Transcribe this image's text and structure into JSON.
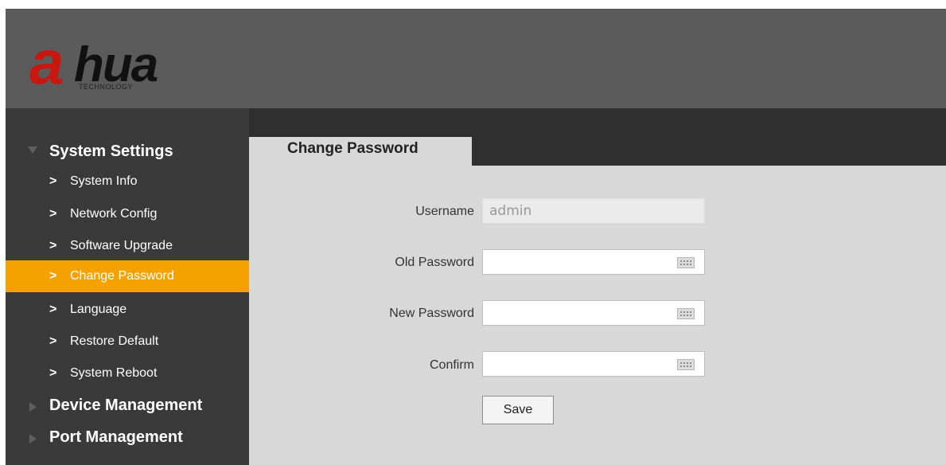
{
  "header": {
    "logo": {
      "brand": "alhua",
      "at_glyph": "a",
      "wordmark": "hua",
      "tagline": "TECHNOLOGY",
      "colors": {
        "red": "#c8170f",
        "black": "#111111"
      }
    }
  },
  "sidebar": {
    "groups": [
      {
        "label": "System Settings",
        "expanded": true,
        "items": [
          {
            "label": "System Info",
            "active": false
          },
          {
            "label": "Network Config",
            "active": false
          },
          {
            "label": "Software Upgrade",
            "active": false
          },
          {
            "label": "Change Password",
            "active": true
          },
          {
            "label": "Language",
            "active": false
          },
          {
            "label": "Restore Default",
            "active": false
          },
          {
            "label": "System Reboot",
            "active": false
          }
        ]
      },
      {
        "label": "Device Management",
        "expanded": false
      },
      {
        "label": "Port Management",
        "expanded": false
      }
    ],
    "item_icon": ">"
  },
  "main": {
    "tab": {
      "label": "Change Password"
    },
    "form": {
      "username": {
        "label": "Username",
        "value": "admin",
        "readonly": true
      },
      "old_password": {
        "label": "Old Password",
        "value": "",
        "icon": "keyboard-icon"
      },
      "new_password": {
        "label": "New Password",
        "value": "",
        "icon": "keyboard-icon"
      },
      "confirm": {
        "label": "Confirm",
        "value": "",
        "icon": "keyboard-icon"
      },
      "save_label": "Save"
    }
  },
  "colors": {
    "header_bg": "#5b5b5b",
    "sidebar_bg": "#3a3a3a",
    "active_item": "#f5a201",
    "content_bg": "#d8d8d8",
    "tabbar_bg": "#2f2f2f"
  }
}
